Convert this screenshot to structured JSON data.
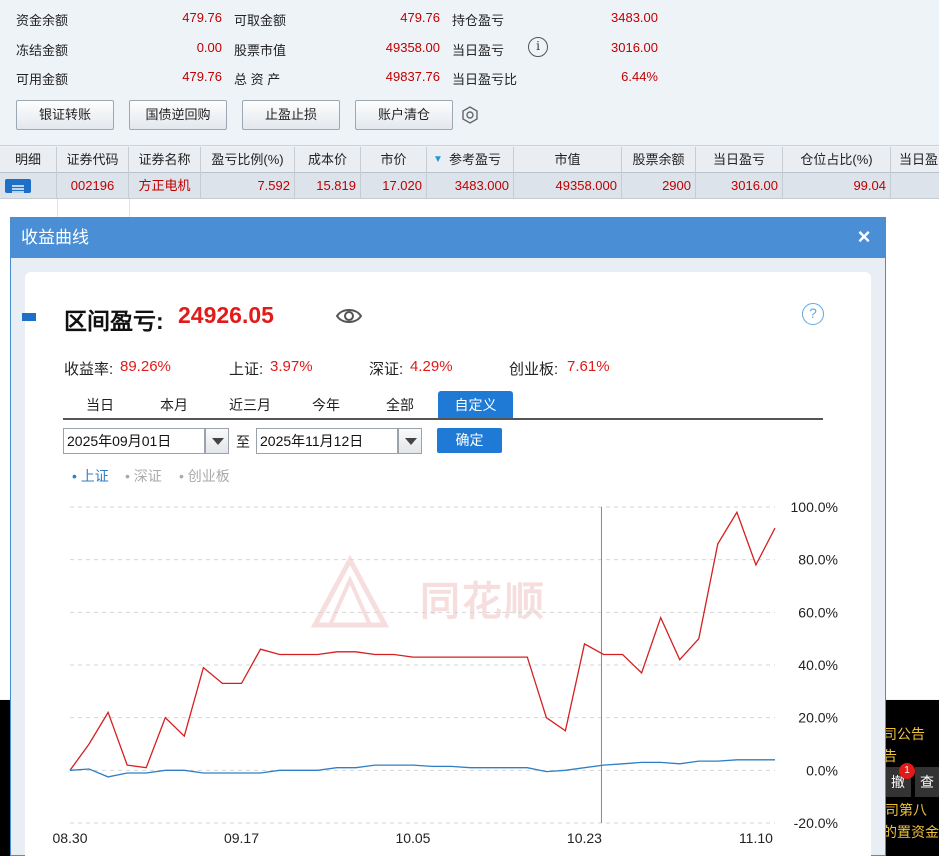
{
  "summary": {
    "rows": [
      [
        {
          "label": "资金余额",
          "value": "479.76"
        },
        {
          "label": "可取金额",
          "value": "479.76"
        },
        {
          "label": "持仓盈亏",
          "value": "3483.00"
        }
      ],
      [
        {
          "label": "冻结金额",
          "value": "0.00"
        },
        {
          "label": "股票市值",
          "value": "49358.00"
        },
        {
          "label": "当日盈亏",
          "value": "3016.00"
        }
      ],
      [
        {
          "label": "可用金额",
          "value": "479.76"
        },
        {
          "label": "总 资 产",
          "value": "49837.76"
        },
        {
          "label": "当日盈亏比",
          "value": "6.44%"
        }
      ]
    ],
    "buttons": [
      "银证转账",
      "国债逆回购",
      "止盈止损",
      "账户清仓"
    ]
  },
  "grid": {
    "headers": [
      "明细",
      "证券代码",
      "证券名称",
      "盈亏比例(%)",
      "成本价",
      "市价",
      "参考盈亏",
      "市值",
      "股票余额",
      "当日盈亏",
      "仓位占比(%)",
      "当日盈"
    ],
    "row": [
      "",
      "002196",
      "方正电机",
      "7.592",
      "15.819",
      "17.020",
      "3483.000",
      "49358.000",
      "2900",
      "3016.00",
      "99.04",
      ""
    ]
  },
  "dialog": {
    "title": "收益曲线",
    "close": "×",
    "pnl_label": "区间盈亏:",
    "pnl_value": "24926.05",
    "help": "?",
    "stats": [
      {
        "label": "收益率:",
        "value": "89.26%"
      },
      {
        "label": "上证:",
        "value": "3.97%"
      },
      {
        "label": "深证:",
        "value": "4.29%"
      },
      {
        "label": "创业板:",
        "value": "7.61%"
      }
    ],
    "tabs": [
      "当日",
      "本月",
      "近三月",
      "今年",
      "全部",
      "自定义"
    ],
    "active_tab": "自定义",
    "date_from": "2025年09月01日",
    "date_sep": "至",
    "date_to": "2025年11月12日",
    "confirm": "确定",
    "legend": [
      "• 上证",
      "• 深证",
      "• 创业板"
    ],
    "watermark": "同花顺"
  },
  "bg_text": [
    "司公告",
    "告",
    "撤",
    "查",
    "司第八",
    "的置资金",
    "1"
  ],
  "colors": {
    "accent": "#1e7ad4",
    "up": "#e11a1a",
    "series_return": "#d42020",
    "series_sh": "#2f7fc6"
  },
  "chart_data": {
    "type": "line",
    "x": [
      "08.30",
      "09.01",
      "09.03",
      "09.05",
      "09.07",
      "09.09",
      "09.11",
      "09.13",
      "09.15",
      "09.17",
      "09.19",
      "09.21",
      "09.23",
      "09.25",
      "09.27",
      "09.29",
      "10.01",
      "10.03",
      "10.05",
      "10.07",
      "10.09",
      "10.11",
      "10.13",
      "10.15",
      "10.17",
      "10.19",
      "10.21",
      "10.23",
      "10.25",
      "10.27",
      "10.29",
      "10.31",
      "11.02",
      "11.04",
      "11.06",
      "11.08",
      "11.10",
      "11.12"
    ],
    "xticks": [
      "08.30",
      "09.17",
      "10.05",
      "10.23",
      "11.10"
    ],
    "series": [
      {
        "name": "收益率",
        "values": [
          0,
          10,
          22,
          2,
          1,
          20,
          13,
          39,
          33,
          33,
          46,
          44,
          44,
          44,
          45,
          45,
          44,
          44,
          43,
          43,
          43,
          43,
          43,
          43,
          43,
          20,
          15,
          48,
          44,
          44,
          37,
          58,
          42,
          50,
          86,
          98,
          78,
          92
        ]
      },
      {
        "name": "上证",
        "values": [
          0,
          0.5,
          -2.5,
          -1,
          -1,
          0,
          0,
          -1,
          -1,
          -1,
          -1,
          0,
          0,
          0,
          1,
          1,
          2,
          2,
          2,
          1.5,
          1.5,
          1,
          1,
          1,
          1,
          -0.5,
          0,
          1,
          2,
          2.5,
          3,
          3,
          2.5,
          3.5,
          3.5,
          4,
          4,
          4
        ]
      }
    ],
    "ylim": [
      -20,
      100
    ],
    "yticks": [
      "100.0%",
      "80.0%",
      "60.0%",
      "40.0%",
      "20.0%",
      "0.0%",
      "-20.0%"
    ],
    "grid": true
  }
}
